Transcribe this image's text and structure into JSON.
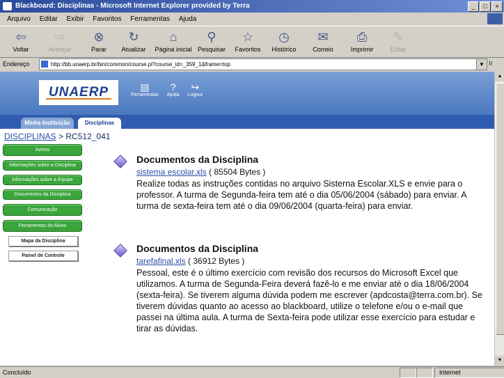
{
  "window": {
    "title": "Blackboard: Disciplinas - Microsoft Internet Explorer provided by Terra",
    "buttons": [
      "_",
      "□",
      "×"
    ]
  },
  "menu": [
    "Arquivo",
    "Editar",
    "Exibir",
    "Favoritos",
    "Ferramentas",
    "Ajuda"
  ],
  "toolbar": {
    "buttons": [
      {
        "label": "Voltar",
        "icon": "back-arrow-icon",
        "glyph": "⇦"
      },
      {
        "label": "Avançar",
        "icon": "forward-arrow-icon",
        "glyph": "⇨"
      },
      {
        "label": "Parar",
        "icon": "stop-icon",
        "glyph": "⊗"
      },
      {
        "label": "Atualizar",
        "icon": "refresh-icon",
        "glyph": "↻"
      },
      {
        "label": "Página inicial",
        "icon": "home-icon",
        "glyph": "⌂"
      },
      {
        "label": "Pesquisar",
        "icon": "search-icon",
        "glyph": "⚲"
      },
      {
        "label": "Favoritos",
        "icon": "favorites-icon",
        "glyph": "☆"
      },
      {
        "label": "Histórico",
        "icon": "history-icon",
        "glyph": "◷"
      },
      {
        "label": "Correio",
        "icon": "mail-icon",
        "glyph": "✉"
      },
      {
        "label": "Imprimir",
        "icon": "print-icon",
        "glyph": "⎙"
      },
      {
        "label": "Editar",
        "icon": "edit-icon",
        "glyph": "✎"
      }
    ]
  },
  "address": {
    "label": "Endereço",
    "url": "http://bb.unaerp.br/bin/common/course.pl?course_id=_359_1&frame=top",
    "go_label": "Ir"
  },
  "header": {
    "logo_text": "UNAERP",
    "icons": [
      {
        "label": "Ferramentas",
        "glyph": "▤"
      },
      {
        "label": "Ajuda",
        "glyph": "?"
      },
      {
        "label": "Logout",
        "glyph": "↪"
      }
    ]
  },
  "tabs": [
    "Minha Instituição",
    "Disciplinas"
  ],
  "breadcrumb": {
    "link": "DISCIPLINAS",
    "separator": " > ",
    "current": "RC512_041"
  },
  "sidenav": {
    "green": [
      "Avisos",
      "Informações sobre a Disciplina",
      "Informações sobre a Equipe",
      "Documentos da Disciplina",
      "Comunicação",
      "Ferramentas do Aluno"
    ],
    "white": [
      "Mapa da Disciplina",
      "Painel de Controle"
    ]
  },
  "items": [
    {
      "title": "Documentos da Disciplina",
      "file": "sistema escolar.xls",
      "size": " ( 85504 Bytes )",
      "description": "Realize todas as instruções contidas no arquivo Sisterna Escolar.XLS e envie para o professor. A turma de Segunda-feira tem até o dia 05/06/2004 (sábado) para enviar. A turma de sexta-feira tem até o dia 09/06/2004 (quarta-feira) para enviar."
    },
    {
      "title": "Documentos da Disciplina",
      "file": "tarefafinal.xls",
      "size": " ( 36912 Bytes )",
      "description": "Pessoal, este é o último exercício com revisão dos recursos do Microsoft Excel que utilizamos. A turma de Segunda-Feira deverá fazê-lo e me enviar até o dia 18/06/2004 (sexta-feira). Se tiverem alguma dúvida podem me escrever (apdcosta@terra.com.br). Se tiverem dúvidas quanto ao acesso ao blackboard, utilize o telefone e/ou o e-mail que passei na última aula. A turma de Sexta-feira pode utilizar esse exercício para estudar e tirar as dúvidas."
    }
  ],
  "status": {
    "text": "Concluído",
    "zone": "Internet"
  }
}
